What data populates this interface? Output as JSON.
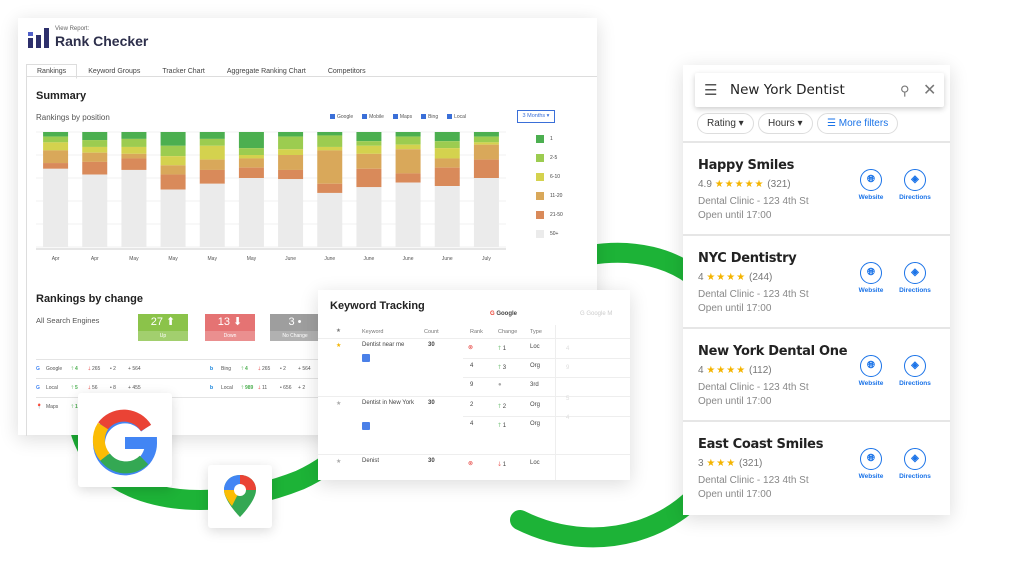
{
  "rank_checker": {
    "subtitle": "View Report:",
    "title": "Rank Checker",
    "tabs": [
      "Rankings",
      "Keyword Groups",
      "Tracker Chart",
      "Aggregate Ranking Chart",
      "Competitors"
    ],
    "summary_title": "Summary",
    "chart_title": "Rankings by position",
    "engine_filters": [
      "Google",
      "Mobile",
      "Maps",
      "Bing",
      "Local"
    ],
    "range_select": "3 Months",
    "change_title": "Rankings by change",
    "all_engines": "All Search Engines",
    "change_boxes": [
      {
        "value": "27",
        "label": "Up",
        "color": "#8bc34a"
      },
      {
        "value": "13",
        "label": "Down",
        "color": "#e57373"
      },
      {
        "value": "3",
        "label": "No Change",
        "color": "#9e9e9e"
      }
    ],
    "engine_rows": [
      {
        "name": "Google",
        "up": "4",
        "down": "265",
        "same": "2",
        "total": "564"
      },
      {
        "name": "Local",
        "up": "5",
        "down": "56",
        "same": "8",
        "total": "455"
      },
      {
        "name": "Maps",
        "up": "1"
      },
      {
        "name": "Bing",
        "up": "4",
        "down": "265",
        "same": "2",
        "total": "564"
      },
      {
        "name": "Local",
        "up": "989",
        "down": "11",
        "same": "656",
        "total": "2"
      }
    ]
  },
  "chart_data": {
    "type": "bar",
    "stacked": true,
    "ylim": [
      0,
      100
    ],
    "grid": true,
    "legend": "right",
    "categories": [
      "Apr",
      "Apr",
      "May",
      "May",
      "May",
      "May",
      "June",
      "June",
      "June",
      "June",
      "June",
      "July"
    ],
    "series": [
      {
        "name": "1",
        "color": "#4caf50",
        "values": [
          4,
          7,
          6,
          12,
          6,
          14,
          4,
          3,
          8,
          4,
          8,
          4
        ]
      },
      {
        "name": "2-5",
        "color": "#9ccc50",
        "values": [
          5,
          6,
          7,
          9,
          6,
          6,
          11,
          10,
          4,
          7,
          6,
          5
        ]
      },
      {
        "name": "6-10",
        "color": "#d4d24e",
        "values": [
          7,
          5,
          6,
          8,
          12,
          3,
          5,
          3,
          7,
          4,
          9,
          2
        ]
      },
      {
        "name": "11-20",
        "color": "#d9a85a",
        "values": [
          11,
          8,
          4,
          8,
          9,
          8,
          13,
          29,
          13,
          21,
          8,
          13
        ]
      },
      {
        "name": "21-50",
        "color": "#d98a5a",
        "values": [
          5,
          11,
          10,
          13,
          12,
          9,
          8,
          8,
          16,
          8,
          16,
          16
        ]
      },
      {
        "name": "50+",
        "color": "#ebebeb",
        "values": [
          68,
          63,
          67,
          50,
          55,
          60,
          59,
          47,
          52,
          56,
          53,
          60
        ]
      }
    ]
  },
  "keyword_tracking": {
    "title": "Keyword Tracking",
    "engine": "Google",
    "engine2": "Google M",
    "headers": [
      "Keyword",
      "Count",
      "Rank",
      "Change",
      "Type"
    ],
    "keywords": [
      {
        "keyword": "Dentist near me",
        "count": "30",
        "starred": true,
        "rows": [
          {
            "rank": "",
            "change": "1",
            "dir": "up",
            "type": "Loc"
          },
          {
            "rank": "4",
            "change": "3",
            "dir": "up",
            "type": "Org"
          },
          {
            "rank": "9",
            "change": "",
            "dir": "none",
            "type": "3rd"
          }
        ]
      },
      {
        "keyword": "Dentist in New York",
        "count": "30",
        "starred": false,
        "rows": [
          {
            "rank": "2",
            "change": "2",
            "dir": "up",
            "type": "Org"
          },
          {
            "rank": "4",
            "change": "1",
            "dir": "up",
            "type": "Org"
          }
        ]
      },
      {
        "keyword": "Denist",
        "count": "30",
        "starred": false,
        "rows": [
          {
            "rank": "",
            "change": "1",
            "dir": "down",
            "type": "Loc"
          }
        ]
      }
    ],
    "faded_ranks": [
      "4",
      "9",
      "5",
      "4"
    ]
  },
  "maps": {
    "query": "New York Dentist",
    "filters": [
      "Rating",
      "Hours",
      "More filters"
    ],
    "website_label": "Website",
    "directions_label": "Directions",
    "results": [
      {
        "name": "Happy Smiles",
        "rating": "4.9",
        "stars": "★★★★★",
        "reviews": "(321)",
        "address": "Dental Clinic - 123 4th St",
        "hours": "Open until 17:00"
      },
      {
        "name": "NYC Dentistry",
        "rating": "4",
        "stars": "★★★★",
        "reviews": "(244)",
        "address": "Dental Clinic - 123 4th St",
        "hours": "Open until 17:00"
      },
      {
        "name": "New York Dental One",
        "rating": "4",
        "stars": "★★★★",
        "reviews": "(112)",
        "address": "Dental Clinic - 123 4th St",
        "hours": "Open until 17:00"
      },
      {
        "name": "East Coast Smiles",
        "rating": "3",
        "stars": "★★★",
        "reviews": "(321)",
        "address": "Dental Clinic - 123 4th St",
        "hours": "Open until 17:00"
      }
    ]
  },
  "colors": {
    "accent_green": "#1db337",
    "link_blue": "#1a73e8",
    "star": "#f4b400"
  }
}
